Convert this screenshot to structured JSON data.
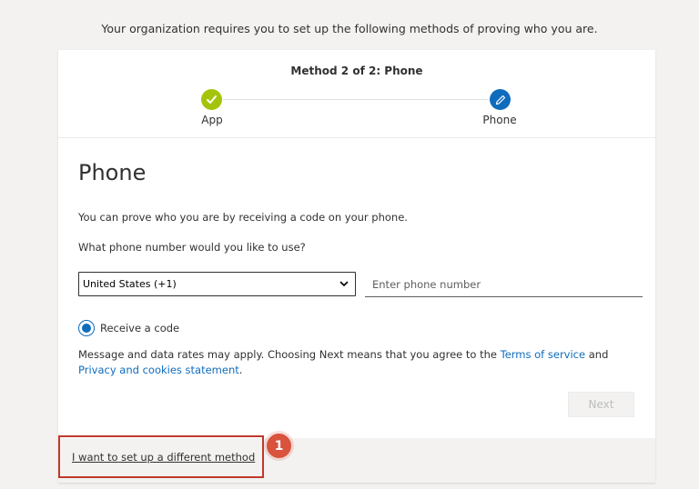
{
  "banner": "Your organization requires you to set up the following methods of proving who you are.",
  "progress": {
    "title": "Method 2 of 2: Phone",
    "steps": [
      {
        "label": "App",
        "state": "done",
        "icon": "checkmark-icon",
        "color": "#a4c40c"
      },
      {
        "label": "Phone",
        "state": "current",
        "icon": "pencil-icon",
        "color": "#0f6cbd"
      }
    ]
  },
  "form": {
    "heading": "Phone",
    "description": "You can prove who you are by receiving a code on your phone.",
    "question": "What phone number would you like to use?",
    "country_value": "United States (+1)",
    "phone_placeholder": "Enter phone number",
    "radio_label": "Receive a code",
    "terms_prefix": "Message and data rates may apply. Choosing Next means that you agree to the ",
    "terms_link": "Terms of service",
    "terms_and": " and ",
    "privacy_link": "Privacy and cookies statement",
    "terms_suffix": ".",
    "next_label": "Next"
  },
  "footer": {
    "alt_method_link": "I want to set up a different method",
    "callout_number": "1"
  },
  "colors": {
    "accent": "#0f6cbd",
    "success": "#a4c40c",
    "annotation": "#c0392b"
  }
}
